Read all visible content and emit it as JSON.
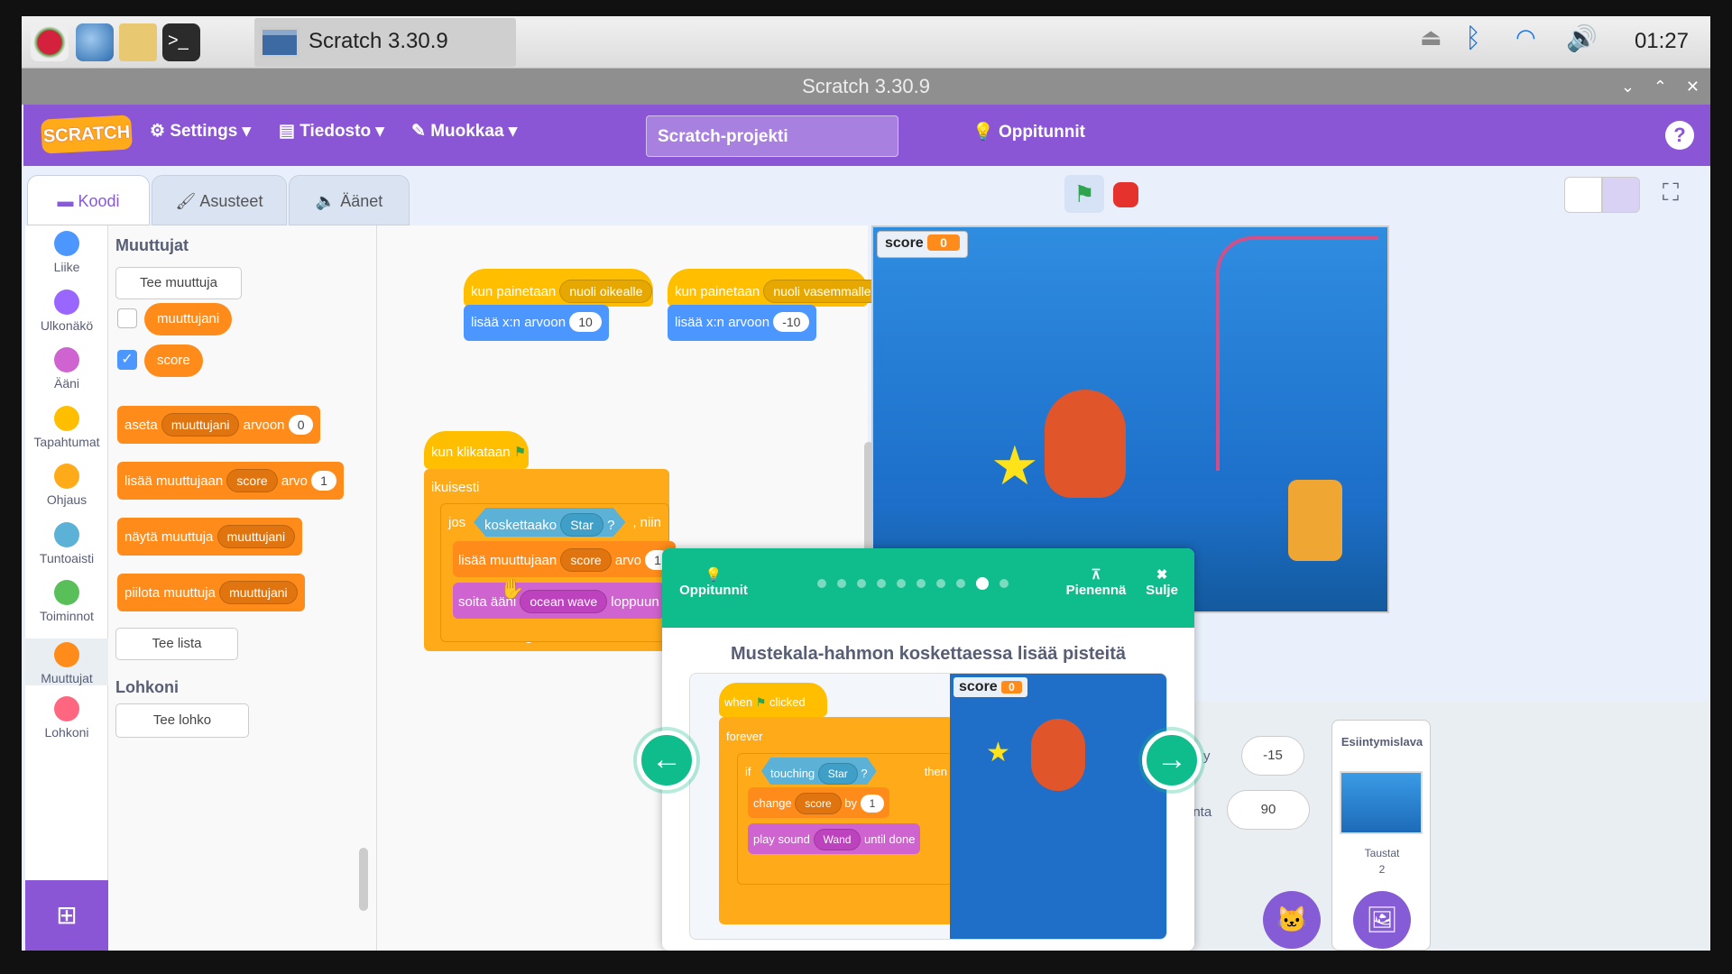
{
  "taskbar": {
    "window_title": "Scratch 3.30.9",
    "clock": "01:27"
  },
  "titlebar": {
    "title": "Scratch 3.30.9"
  },
  "menu": {
    "settings": "Settings",
    "file": "Tiedosto",
    "edit": "Muokkaa",
    "project_title": "Scratch-projekti",
    "tutorials": "Oppitunnit",
    "help": "?",
    "logo": "SCRATCH"
  },
  "tabs": {
    "code": "Koodi",
    "costumes": "Asusteet",
    "sounds": "Äänet"
  },
  "categories": [
    "Liike",
    "Ulkonäkö",
    "Ääni",
    "Tapahtumat",
    "Ohjaus",
    "Tuntoaisti",
    "Toiminnot",
    "Muuttujat",
    "Lohkoni"
  ],
  "category_colors": [
    "#4c97ff",
    "#9966ff",
    "#cf63cf",
    "#ffbf00",
    "#ffab19",
    "#5cb1d6",
    "#59c059",
    "#ff8c1a",
    "#ff6680"
  ],
  "palette": {
    "vars_header": "Muuttujat",
    "make_var": "Tee muuttuja",
    "var1": "muuttujani",
    "var2": "score",
    "set_block": {
      "a": "aseta",
      "var": "muuttujani",
      "b": "arvoon",
      "val": "0"
    },
    "change_block": {
      "a": "lisää muuttujaan",
      "var": "score",
      "b": "arvo",
      "val": "1"
    },
    "show_block": {
      "a": "näytä muuttuja",
      "var": "muuttujani"
    },
    "hide_block": {
      "a": "piilota muuttuja",
      "var": "muuttujani"
    },
    "make_list": "Tee lista",
    "myblocks_header": "Lohkoni",
    "make_block": "Tee lohko"
  },
  "script": {
    "hat1": "kun painetaan",
    "key1": "nuoli oikealle",
    "move1": "lisää x:n arvoon",
    "val1": "10",
    "hat2": "kun painetaan",
    "key2": "nuoli vasemmalle",
    "move2": "lisää x:n arvoon",
    "val2": "-10",
    "flag_hat": "kun klikataan",
    "forever": "ikuisesti",
    "if": "jos",
    "touching": "koskettaako",
    "star": "Star",
    "q": "?",
    "then": ", niin",
    "change": "lisää muuttujaan",
    "score": "score",
    "arvo": "arvo",
    "one": "1",
    "play": "soita ääni",
    "sound": "ocean wave",
    "until": "loppuun"
  },
  "stage": {
    "score_label": "score",
    "score_value": "0"
  },
  "tutorial": {
    "label": "Oppitunnit",
    "minimize": "Pienennä",
    "close": "Sulje",
    "title": "Mustekala-hahmon koskettaessa lisää pisteitä",
    "when": "when",
    "clicked": "clicked",
    "forever": "forever",
    "if": "if",
    "touching": "touching",
    "star": "Star",
    "q": "?",
    "then": "then",
    "change": "change",
    "score": "score",
    "by": "by",
    "one": "1",
    "play": "play sound",
    "wand": "Wand",
    "until": "until done",
    "preview_score": "score",
    "preview_val": "0",
    "dots": 10,
    "active_dot": 9
  },
  "sprite_info": {
    "y_label": "y",
    "y_value": "-15",
    "dir_label": "unta",
    "dir_value": "90",
    "stage_label": "Esiintymislava",
    "backdrops_label": "Taustat",
    "backdrops_count": "2"
  }
}
